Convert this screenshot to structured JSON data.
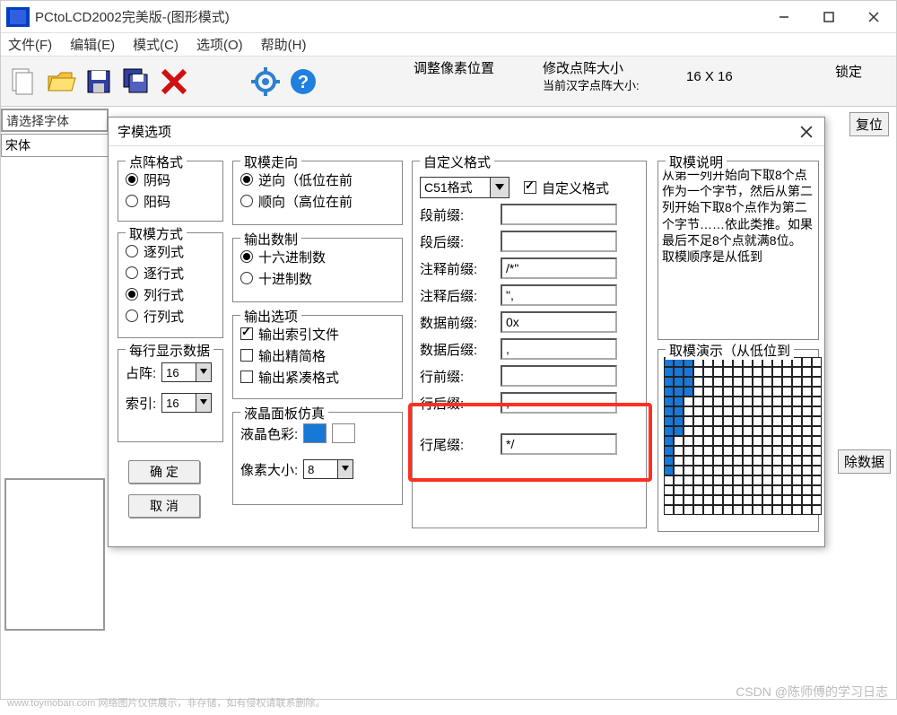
{
  "window": {
    "title": "PCtoLCD2002完美版-(图形模式)",
    "menu": {
      "file": "文件(F)",
      "edit": "编辑(E)",
      "mode": "模式(C)",
      "options": "选项(O)",
      "help": "帮助(H)"
    },
    "toolbar": {
      "adjust_pixel": "调整像素位置",
      "modify_matrix": "修改点阵大小",
      "current_matrix": "当前汉字点阵大小:",
      "dims": "16 X 16",
      "lock": "锁定",
      "reset": "复位"
    },
    "font_select_label": "请选择字体",
    "font_select_value": "宋体",
    "clear_data": "除数据"
  },
  "dialog": {
    "title": "字模选项",
    "matrix_format": {
      "title": "点阵格式",
      "opt1": "阴码",
      "opt2": "阳码",
      "selected": 0
    },
    "extract_dir": {
      "title": "取模走向",
      "opt1": "逆向（低位在前",
      "opt2": "顺向（高位在前",
      "selected": 0
    },
    "extract_mode": {
      "title": "取模方式",
      "opt1": "逐列式",
      "opt2": "逐行式",
      "opt3": "列行式",
      "opt4": "行列式",
      "selected": 2
    },
    "output_base": {
      "title": "输出数制",
      "opt1": "十六进制数",
      "opt2": "十进制数",
      "selected": 0
    },
    "output_opts": {
      "title": "输出选项",
      "opt1": "输出索引文件",
      "opt2": "输出精简格",
      "opt3": "输出紧凑格式",
      "chk1": true,
      "chk2": false,
      "chk3": false
    },
    "per_line": {
      "title": "每行显示数据",
      "lbl1": "占阵:",
      "lbl2": "索引:",
      "v1": "16",
      "v2": "16"
    },
    "lcd_sim": {
      "title": "液晶面板仿真",
      "color_lbl": "液晶色彩:",
      "size_lbl": "像素大小:",
      "size_val": "8"
    },
    "custom_fmt": {
      "title": "自定义格式",
      "format_sel": "C51格式",
      "custom_chk": "自定义格式",
      "seg_pre_lbl": "段前缀:",
      "seg_pre_val": "",
      "seg_suf_lbl": "段后缀:",
      "seg_suf_val": "",
      "cmt_pre_lbl": "注释前缀:",
      "cmt_pre_val": "/*\"",
      "cmt_suf_lbl": "注释后缀:",
      "cmt_suf_val": "\",",
      "data_pre_lbl": "数据前缀:",
      "data_pre_val": "0x",
      "data_suf_lbl": "数据后缀:",
      "data_suf_val": ",",
      "line_pre_lbl": "行前缀:",
      "line_pre_val": "",
      "line_suf_lbl": "行后缀:",
      "line_suf_val": ",",
      "line_tail_lbl": "行尾缀:",
      "line_tail_val": "*/"
    },
    "desc": {
      "title": "取模说明",
      "text": "从第一列开始向下取8个点作为一个字节，然后从第二列开始下取8个点作为第二个字节……依此类推。如果最后不足8个点就满8位。\n取模顺序是从低到"
    },
    "demo": {
      "title": "取模演示（从低位到"
    },
    "ok": "确 定",
    "cancel": "取 消"
  },
  "watermark": {
    "left": "www.toymoban.com 网络图片仅供展示，非存储，如有侵权请联系删除。",
    "right": "CSDN @陈师傅的学习日志"
  },
  "chart_data": {
    "type": "heatmap",
    "title": "取模演示",
    "grid_size": [
      16,
      16
    ],
    "on_cells": [
      [
        0,
        0
      ],
      [
        0,
        1
      ],
      [
        0,
        2
      ],
      [
        1,
        0
      ],
      [
        1,
        1
      ],
      [
        1,
        2
      ],
      [
        2,
        0
      ],
      [
        2,
        1
      ],
      [
        2,
        2
      ],
      [
        3,
        0
      ],
      [
        3,
        1
      ],
      [
        3,
        2
      ],
      [
        4,
        0
      ],
      [
        4,
        1
      ],
      [
        5,
        0
      ],
      [
        5,
        1
      ],
      [
        6,
        0
      ],
      [
        6,
        1
      ],
      [
        7,
        0
      ],
      [
        7,
        1
      ],
      [
        8,
        0
      ],
      [
        9,
        0
      ],
      [
        10,
        0
      ],
      [
        11,
        0
      ]
    ]
  }
}
